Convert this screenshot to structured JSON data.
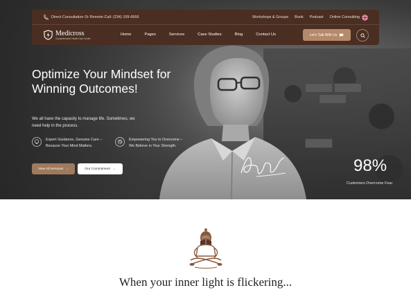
{
  "topbar": {
    "contact": "Direct Consultation Or Remote Call: (234) 109-6666",
    "links": [
      "Workshops & Groups",
      "Book",
      "Podcast",
      "Online Consulting"
    ]
  },
  "brand": {
    "name": "Medicross",
    "tagline": "Comprehensive Health Care Center"
  },
  "nav": {
    "items": [
      "Home",
      "Pages",
      "Services",
      "Case Studies",
      "Blog",
      "Contact Us"
    ],
    "cta": "Let's Talk With Us"
  },
  "hero": {
    "title": "Optimize Your Mindset for Winning Outcomes!",
    "description": "We all have the capacity to manage life. Sometimes, we need help in the process.",
    "features": [
      {
        "icon": "lightbulb-icon",
        "text": "Expert Guidance, Genuine Care – Because Your Mind Matters."
      },
      {
        "icon": "brain-head-icon",
        "text": "Empowering You to Overcome – We Believe in Your Strength."
      }
    ],
    "primary_button": "View All Services",
    "secondary_button": "Our Commitment",
    "stat_value": "98%",
    "stat_label": "Customers Overcome Fear"
  },
  "section": {
    "heading": "When your inner light is flickering..."
  },
  "colors": {
    "nav_bg": "#4a2e22",
    "accent": "#b58a6a",
    "button_primary": "#a07a5c",
    "icon_brown": "#8a5a3c"
  }
}
